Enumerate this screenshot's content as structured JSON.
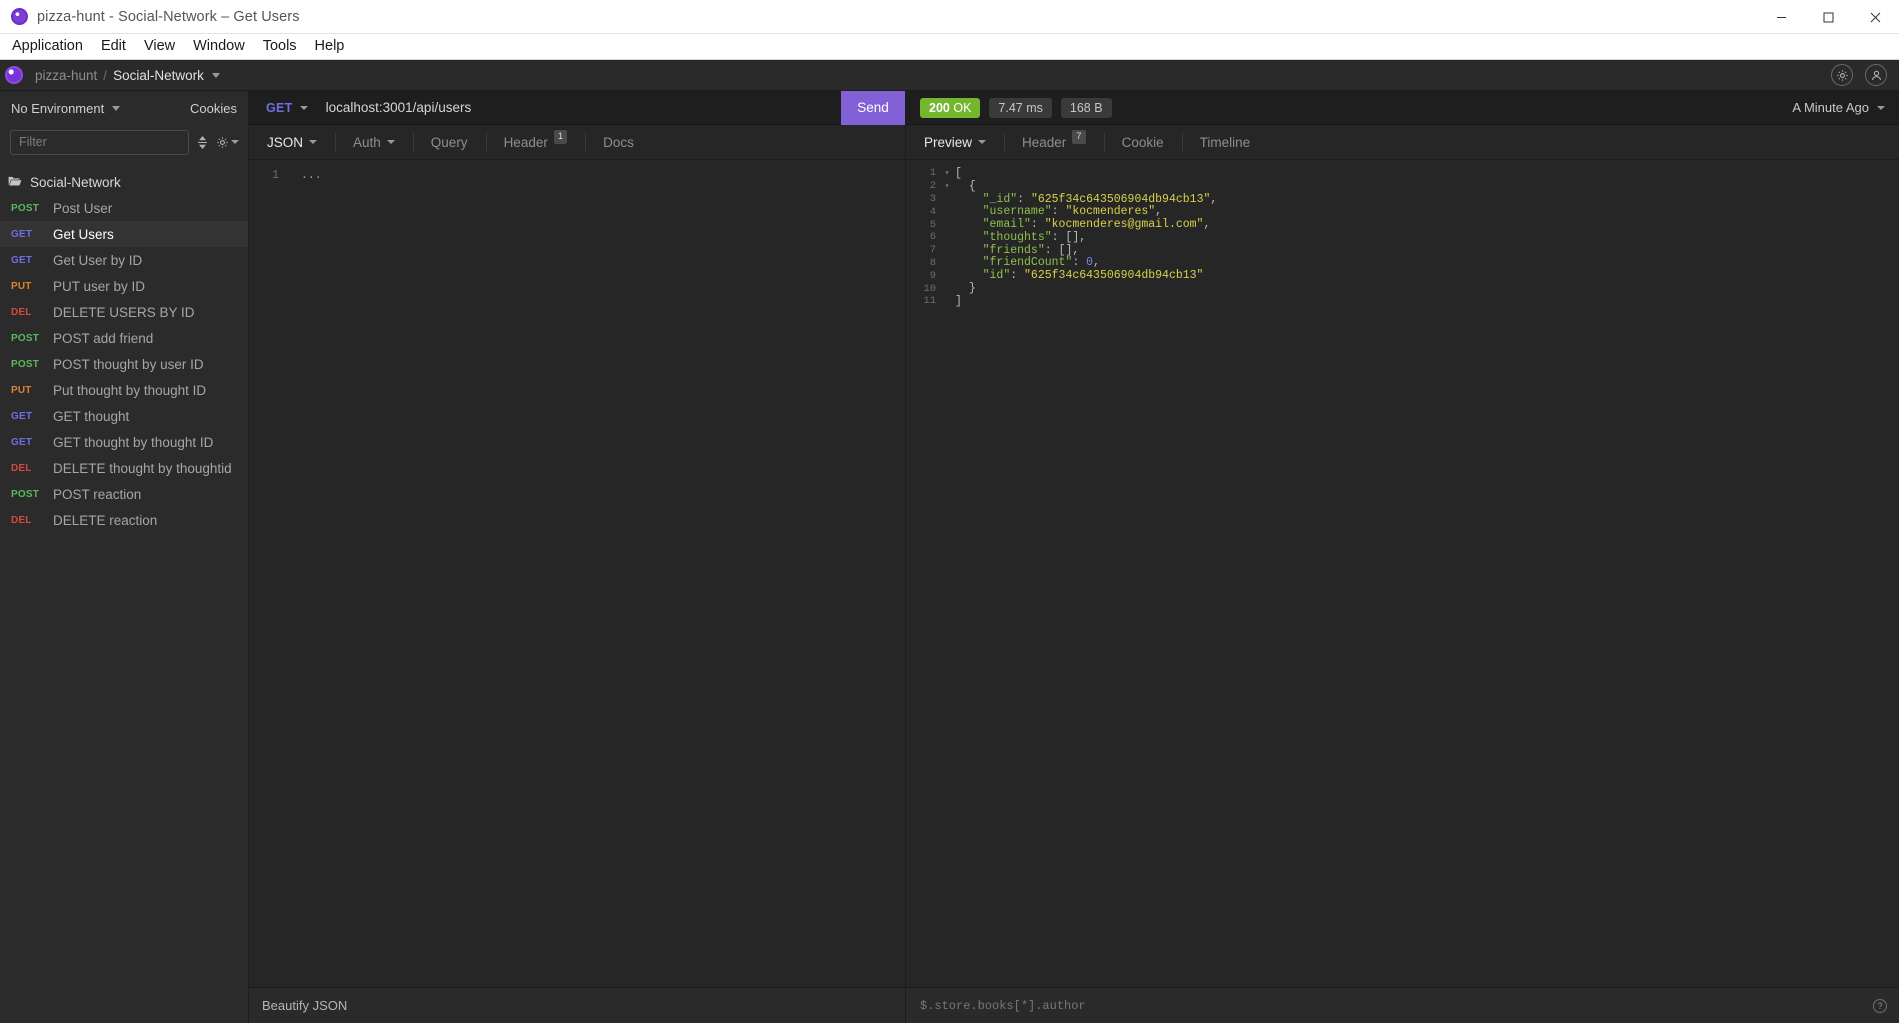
{
  "window": {
    "title": "pizza-hunt - Social-Network – Get Users",
    "app_icon": "insomnia-orb-icon",
    "controls": [
      {
        "name": "minimize-button",
        "glyph": "minimize-icon"
      },
      {
        "name": "maximize-button",
        "glyph": "maximize-icon"
      },
      {
        "name": "close-button",
        "glyph": "close-icon"
      }
    ]
  },
  "menubar": {
    "items": [
      "Application",
      "Edit",
      "View",
      "Window",
      "Tools",
      "Help"
    ]
  },
  "appheader": {
    "org": "pizza-hunt",
    "separator": "/",
    "workspace": "Social-Network",
    "icons": [
      "gear-icon",
      "user-avatar-icon"
    ]
  },
  "sidebar": {
    "environment": "No Environment",
    "cookies_label": "Cookies",
    "filter_placeholder": "Filter",
    "sort_icon": "sort-updown-icon",
    "settings_icon": "gear-plus-icon",
    "folder": {
      "name": "Social-Network",
      "icon": "folder-open-icon"
    },
    "requests": [
      {
        "method": "POST",
        "name": "Post User"
      },
      {
        "method": "GET",
        "name": "Get Users"
      },
      {
        "method": "GET",
        "name": "Get User by ID"
      },
      {
        "method": "PUT",
        "name": "PUT user by ID"
      },
      {
        "method": "DEL",
        "name": "DELETE USERS BY ID"
      },
      {
        "method": "POST",
        "name": "POST add friend"
      },
      {
        "method": "POST",
        "name": "POST thought by user ID"
      },
      {
        "method": "PUT",
        "name": "Put thought by thought ID"
      },
      {
        "method": "GET",
        "name": "GET thought"
      },
      {
        "method": "GET",
        "name": "GET thought by thought ID"
      },
      {
        "method": "DEL",
        "name": "DELETE thought by thoughtid"
      },
      {
        "method": "POST",
        "name": "POST reaction"
      },
      {
        "method": "DEL",
        "name": "DELETE reaction"
      }
    ],
    "active_index": 1
  },
  "request": {
    "method": "GET",
    "url": "localhost:3001/api/users",
    "send_label": "Send",
    "tabs": [
      {
        "label": "JSON",
        "active": true,
        "dropdown": true,
        "badge": ""
      },
      {
        "label": "Auth",
        "active": false,
        "dropdown": true,
        "badge": ""
      },
      {
        "label": "Query",
        "active": false,
        "dropdown": false,
        "badge": ""
      },
      {
        "label": "Header",
        "active": false,
        "dropdown": false,
        "badge": "1"
      },
      {
        "label": "Docs",
        "active": false,
        "dropdown": false,
        "badge": ""
      }
    ],
    "body_lines": [
      {
        "num": "1",
        "text": "..."
      }
    ],
    "beautify_label": "Beautify JSON"
  },
  "response": {
    "status_code": "200",
    "status_text": "OK",
    "time": "7.47 ms",
    "size": "168 B",
    "history_label": "A Minute Ago",
    "tabs": [
      {
        "label": "Preview",
        "active": true,
        "dropdown": true,
        "badge": ""
      },
      {
        "label": "Header",
        "active": false,
        "dropdown": false,
        "badge": "7"
      },
      {
        "label": "Cookie",
        "active": false,
        "dropdown": false,
        "badge": ""
      },
      {
        "label": "Timeline",
        "active": false,
        "dropdown": false,
        "badge": ""
      }
    ],
    "jsonpath_placeholder": "$.store.books[*].author",
    "help_icon": "question-mark-icon",
    "body": [
      {
        "num": "1",
        "fold": "▾",
        "indent": 0,
        "tokens": [
          {
            "t": "pun",
            "v": "["
          }
        ]
      },
      {
        "num": "2",
        "fold": "▾",
        "indent": 1,
        "tokens": [
          {
            "t": "pun",
            "v": "{"
          }
        ]
      },
      {
        "num": "3",
        "fold": "",
        "indent": 2,
        "tokens": [
          {
            "t": "key",
            "v": "\"_id\""
          },
          {
            "t": "pun",
            "v": ": "
          },
          {
            "t": "str",
            "v": "\"625f34c643506904db94cb13\""
          },
          {
            "t": "pun",
            "v": ","
          }
        ]
      },
      {
        "num": "4",
        "fold": "",
        "indent": 2,
        "tokens": [
          {
            "t": "key",
            "v": "\"username\""
          },
          {
            "t": "pun",
            "v": ": "
          },
          {
            "t": "str",
            "v": "\"kocmenderes\""
          },
          {
            "t": "pun",
            "v": ","
          }
        ]
      },
      {
        "num": "5",
        "fold": "",
        "indent": 2,
        "tokens": [
          {
            "t": "key",
            "v": "\"email\""
          },
          {
            "t": "pun",
            "v": ": "
          },
          {
            "t": "str",
            "v": "\"kocmenderes@gmail.com\""
          },
          {
            "t": "pun",
            "v": ","
          }
        ]
      },
      {
        "num": "6",
        "fold": "",
        "indent": 2,
        "tokens": [
          {
            "t": "key",
            "v": "\"thoughts\""
          },
          {
            "t": "pun",
            "v": ": [],"
          }
        ]
      },
      {
        "num": "7",
        "fold": "",
        "indent": 2,
        "tokens": [
          {
            "t": "key",
            "v": "\"friends\""
          },
          {
            "t": "pun",
            "v": ": [],"
          }
        ]
      },
      {
        "num": "8",
        "fold": "",
        "indent": 2,
        "tokens": [
          {
            "t": "key",
            "v": "\"friendCount\""
          },
          {
            "t": "pun",
            "v": ": "
          },
          {
            "t": "num",
            "v": "0"
          },
          {
            "t": "pun",
            "v": ","
          }
        ]
      },
      {
        "num": "9",
        "fold": "",
        "indent": 2,
        "tokens": [
          {
            "t": "key",
            "v": "\"id\""
          },
          {
            "t": "pun",
            "v": ": "
          },
          {
            "t": "str",
            "v": "\"625f34c643506904db94cb13\""
          }
        ]
      },
      {
        "num": "10",
        "fold": "",
        "indent": 1,
        "tokens": [
          {
            "t": "pun",
            "v": "}"
          }
        ]
      },
      {
        "num": "11",
        "fold": "",
        "indent": 0,
        "tokens": [
          {
            "t": "pun",
            "v": "]"
          }
        ]
      }
    ]
  },
  "colors": {
    "accent_purple": "#8261d6",
    "status_green": "#74b72e",
    "method_post": "#5cb85c",
    "method_get": "#6e6ee6",
    "method_put": "#e08030",
    "method_del": "#cf4a3f"
  }
}
